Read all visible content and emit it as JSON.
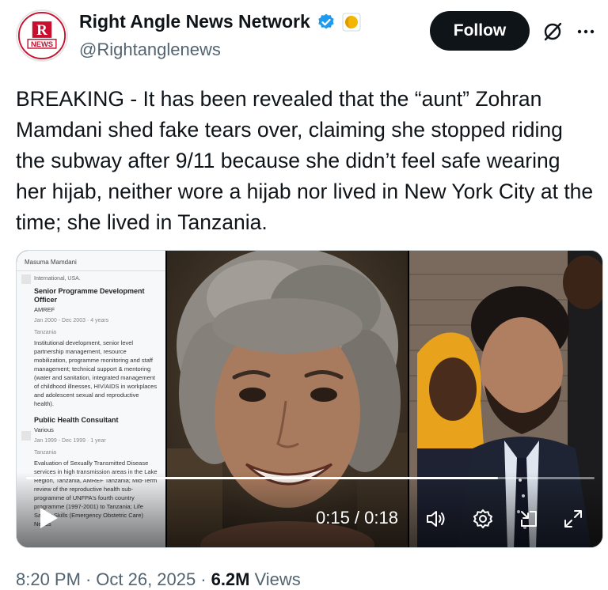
{
  "author": {
    "display_name": "Right Angle News Network",
    "handle": "@Rightanglenews",
    "avatar_text_top": "RIGHT ANGLE",
    "avatar_text_bottom": "NEWS"
  },
  "actions": {
    "follow_label": "Follow"
  },
  "tweet": {
    "text": "BREAKING - It has been revealed that the “aunt” Zohran Mamdani shed fake tears over, claiming she stopped riding the subway after 9/11 because she didn’t feel safe wearing her hijab, neither wore a hijab nor lived in New York City at the time; she lived in Tanzania."
  },
  "media": {
    "document": {
      "header": "Masuma Mamdani",
      "cut_text": "International, USA.",
      "job1_title": "Senior Programme Development Officer",
      "job1_org": "AMREF",
      "job1_dates": "Jan 2000 - Dec 2003 · 4 years",
      "job1_location": "Tanzania",
      "job1_desc": "Institutional development, senior level partnership management, resource mobilization, programme monitoring and staff management; technical support & mentoring (water and sanitation, integrated management of childhood illnesses, HIV/AIDS in workplaces and adolescent sexual and reproductive health).",
      "job2_title": "Public Health Consultant",
      "job2_org": "Various",
      "job2_dates": "Jan 1999 - Dec 1999 · 1 year",
      "job2_location": "Tanzania",
      "job2_desc": "Evaluation of Sexually Transmitted Disease services in high transmission areas in the Lake Region, Tanzania, AMREF Tanzania; Mid-Term review of the reproductive health sub-programme of UNFPA's fourth country programme (1997-2001) to Tanzania; Life Saving Skills (Emergency Obstetric Care) Needs"
    },
    "video": {
      "time": "0:15 / 0:18",
      "progress": 0.83
    }
  },
  "footer": {
    "time": "8:20 PM",
    "date": "Oct 26, 2025",
    "views_count": "6.2M",
    "views_label": "Views"
  },
  "colors": {
    "verified": "#1d9bf0",
    "follow_bg": "#0f1419",
    "secondary_text": "#536471"
  },
  "icons": [
    "verified-badge-icon",
    "affiliate-badge-icon",
    "grok-icon",
    "more-icon",
    "play-icon",
    "volume-icon",
    "settings-icon",
    "pip-icon",
    "fullscreen-icon"
  ]
}
